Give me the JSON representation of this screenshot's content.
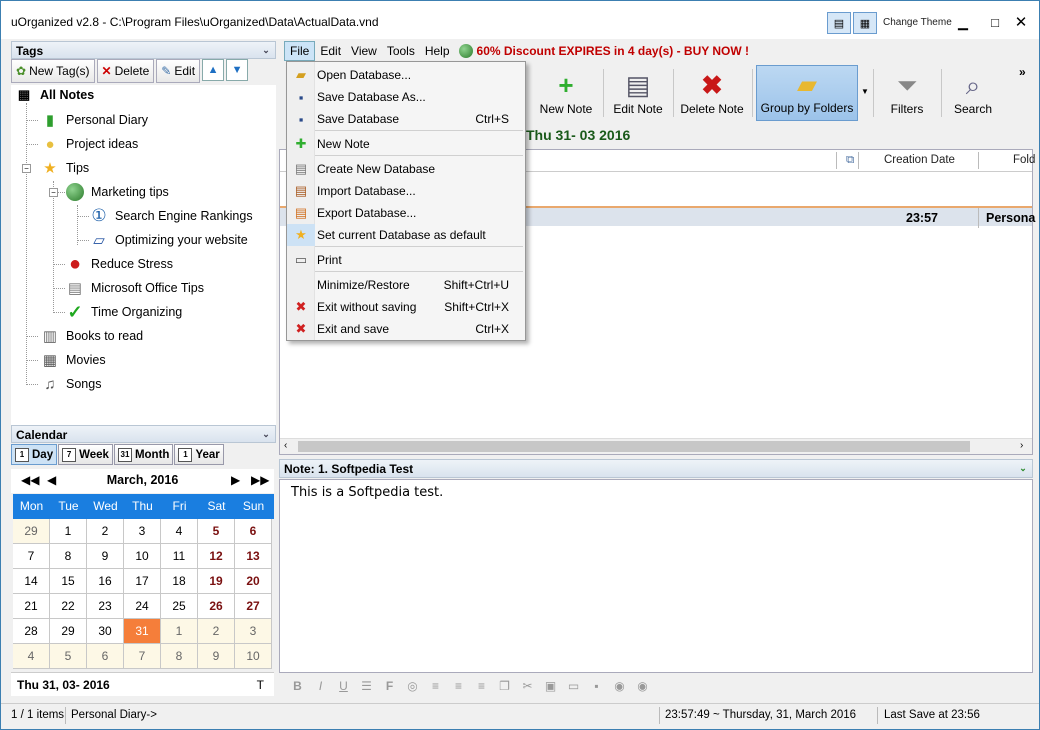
{
  "window": {
    "title": "uOrganized v2.8 - C:\\Program Files\\uOrganized\\Data\\ActualData.vnd",
    "change_theme": "Change Theme"
  },
  "tags": {
    "header": "Tags",
    "new_tag": "New Tag(s)",
    "delete": "Delete",
    "edit": "Edit",
    "all_notes": "All Notes",
    "items": [
      {
        "label": "Personal Diary",
        "icon": "green-book-icon"
      },
      {
        "label": "Project ideas",
        "icon": "lightbulb-icon"
      },
      {
        "label": "Tips",
        "icon": "star-icon"
      },
      {
        "label": "Marketing tips",
        "icon": "globe-icon"
      },
      {
        "label": "Search Engine Rankings",
        "icon": "number-one-icon"
      },
      {
        "label": "Optimizing your website",
        "icon": "monitor-icon"
      },
      {
        "label": "Reduce Stress",
        "icon": "red-circle-icon"
      },
      {
        "label": "Microsoft Office Tips",
        "icon": "document-icon"
      },
      {
        "label": "Time Organizing",
        "icon": "checkmark-icon"
      },
      {
        "label": "Books to read",
        "icon": "books-icon"
      },
      {
        "label": "Movies",
        "icon": "film-icon"
      },
      {
        "label": "Songs",
        "icon": "music-note-icon"
      }
    ]
  },
  "calendar": {
    "header": "Calendar",
    "tabs": [
      {
        "label": "Day",
        "num": "1"
      },
      {
        "label": "Week",
        "num": "7"
      },
      {
        "label": "Month",
        "num": "31"
      },
      {
        "label": "Year",
        "num": "1"
      }
    ],
    "month": "March, 2016",
    "weekdays": [
      "Mon",
      "Tue",
      "Wed",
      "Thu",
      "Fri",
      "Sat",
      "Sun"
    ],
    "weeks": [
      [
        "29",
        "1",
        "2",
        "3",
        "4",
        "5",
        "6"
      ],
      [
        "7",
        "8",
        "9",
        "10",
        "11",
        "12",
        "13"
      ],
      [
        "14",
        "15",
        "16",
        "17",
        "18",
        "19",
        "20"
      ],
      [
        "21",
        "22",
        "23",
        "24",
        "25",
        "26",
        "27"
      ],
      [
        "28",
        "29",
        "30",
        "31",
        "1",
        "2",
        "3"
      ],
      [
        "4",
        "5",
        "6",
        "7",
        "8",
        "9",
        "10"
      ]
    ],
    "footer_date": "Thu 31, 03- 2016",
    "footer_t": "T"
  },
  "menu": {
    "items": [
      "File",
      "Edit",
      "View",
      "Tools",
      "Help"
    ],
    "promo": "60% Discount EXPIRES in 4 day(s) - BUY NOW !"
  },
  "toolbar": {
    "new_note": "New Note",
    "edit_note": "Edit Note",
    "delete_note": "Delete Note",
    "group_by_folders": "Group by Folders",
    "filters": "Filters",
    "search": "Search",
    "more": "»"
  },
  "list": {
    "date_header": "Thu 31- 03 2016",
    "col_creation": "Creation Date",
    "col_folder": "Fold",
    "row_time": "23:57",
    "row_folder": "Persona"
  },
  "note": {
    "header": "Note: 1. Softpedia Test",
    "body": "This is a Softpedia test."
  },
  "status": {
    "items": "1 / 1 items",
    "path": "Personal Diary->",
    "datetime": "23:57:49  ~  Thursday, 31, March 2016",
    "last_save": "Last Save at 23:56"
  },
  "file_menu": [
    {
      "label": "Open Database...",
      "shortcut": "",
      "icon": "open-folder-icon"
    },
    {
      "label": "Save Database As...",
      "shortcut": "",
      "icon": "save-as-icon"
    },
    {
      "label": "Save Database",
      "shortcut": "Ctrl+S",
      "icon": "save-icon"
    },
    {
      "label": "New Note",
      "shortcut": "",
      "icon": "plus-icon"
    },
    {
      "label": "Create New Database",
      "shortcut": "",
      "icon": "new-database-icon"
    },
    {
      "label": "Import Database...",
      "shortcut": "",
      "icon": "import-icon"
    },
    {
      "label": "Export Database...",
      "shortcut": "",
      "icon": "export-icon"
    },
    {
      "label": "Set current Database as default",
      "shortcut": "",
      "icon": "star-default-icon"
    },
    {
      "label": "Print",
      "shortcut": "",
      "icon": "printer-icon"
    },
    {
      "label": "Minimize/Restore",
      "shortcut": "Shift+Ctrl+U",
      "icon": ""
    },
    {
      "label": "Exit without saving",
      "shortcut": "Shift+Ctrl+X",
      "icon": "exit-nosave-icon"
    },
    {
      "label": "Exit and save",
      "shortcut": "Ctrl+X",
      "icon": "exit-save-icon"
    }
  ],
  "colors": {
    "accent": "#1a7ee0",
    "today": "#f57e3a",
    "promo": "#c00000"
  }
}
